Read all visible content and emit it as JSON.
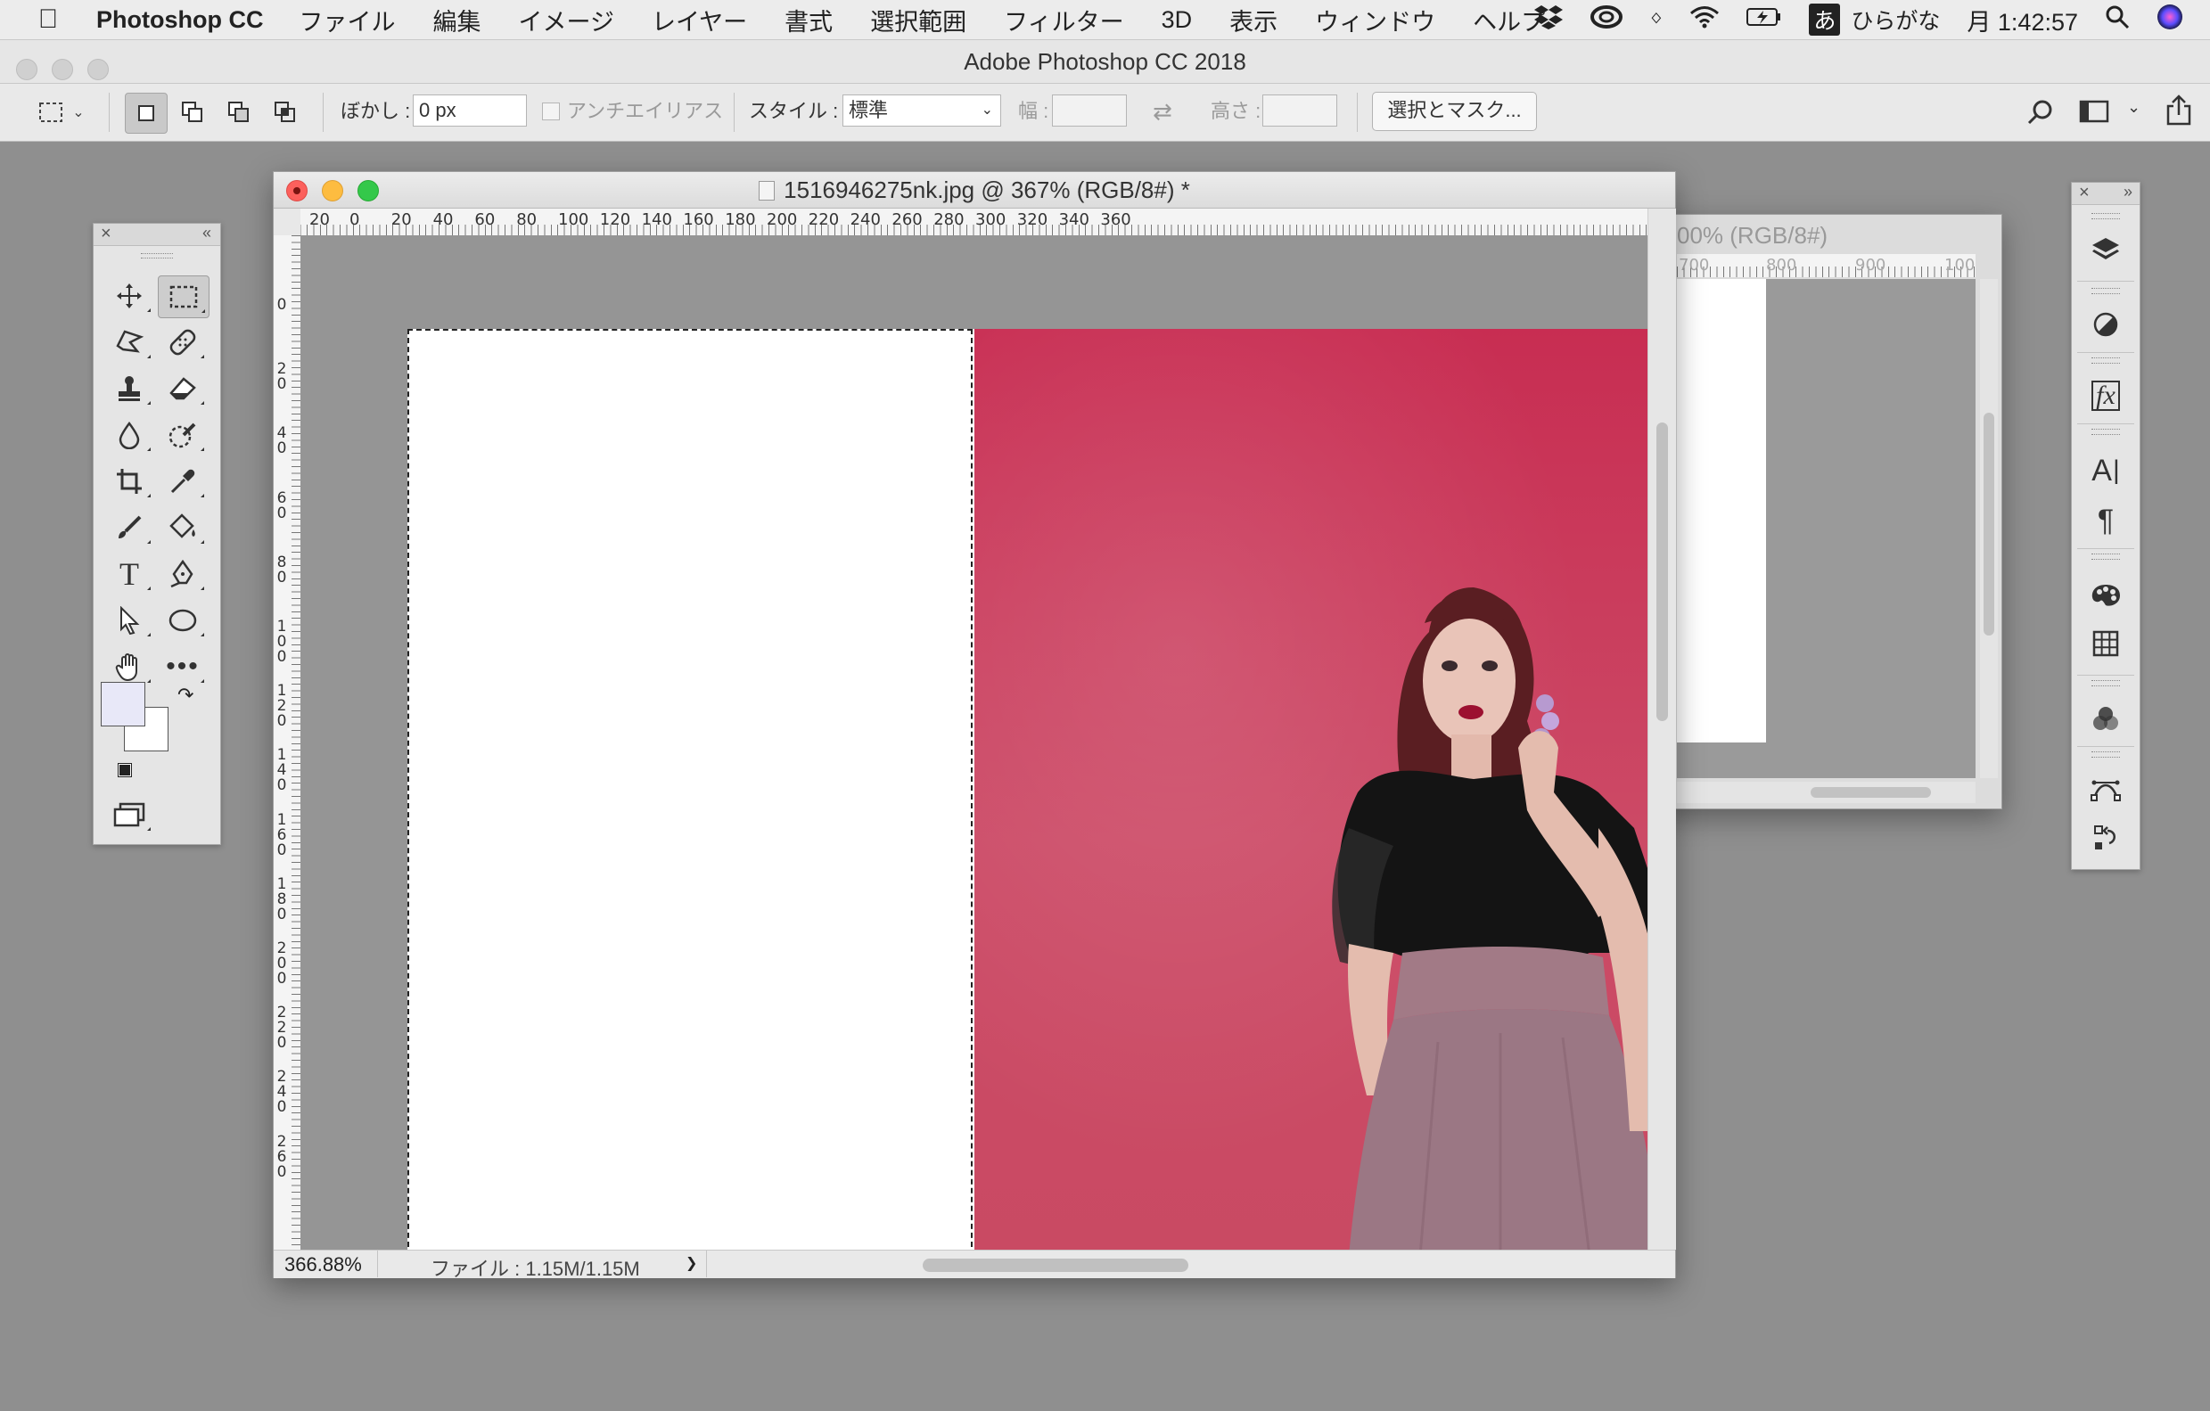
{
  "menubar": {
    "app_name": "Photoshop CC",
    "items": [
      "ファイル",
      "編集",
      "イメージ",
      "レイヤー",
      "書式",
      "選択範囲",
      "フィルター",
      "3D",
      "表示",
      "ウィンドウ",
      "ヘルプ"
    ],
    "ime_mark": "あ",
    "ime_label": "ひらがな",
    "clock": "月 1:42:57"
  },
  "app_title": "Adobe Photoshop CC 2018",
  "options": {
    "feather_label": "ぼかし :",
    "feather_value": "0 px",
    "antialias_label": "アンチエイリアス",
    "style_label": "スタイル :",
    "style_value": "標準",
    "width_label": "幅 :",
    "height_label": "高さ :",
    "select_mask_button": "選択とマスク..."
  },
  "document": {
    "title": "1516946275nk.jpg @ 367% (RGB/8#) *",
    "zoom": "366.88%",
    "file_info": "ファイル : 1.15M/1.15M",
    "status_arrow": "❯",
    "h_ruler_labels": [
      "20",
      "0",
      "20",
      "40",
      "60",
      "80",
      "100",
      "120",
      "140",
      "160",
      "180",
      "200",
      "220",
      "240",
      "260",
      "280",
      "300",
      "320",
      "340",
      "360"
    ],
    "v_ruler_labels": [
      "0",
      "20",
      "40",
      "60",
      "80",
      "100",
      "120",
      "140",
      "160",
      "180",
      "200",
      "220",
      "240",
      "260"
    ]
  },
  "back_document": {
    "title_fragment": "00% (RGB/8#)",
    "ruler_labels": [
      "700",
      "800",
      "900",
      "100"
    ]
  },
  "colors": {
    "foreground": "#e8e8f8",
    "background": "#ffffff",
    "photo_bg": "#c8345a"
  },
  "icons": {
    "tools": [
      "move-icon",
      "marquee-icon",
      "lasso-icon",
      "healing-icon",
      "stamp-icon",
      "eraser-icon",
      "blur-icon",
      "quick-select-icon",
      "crop-icon",
      "eyedropper-icon",
      "brush-icon",
      "paint-bucket-icon",
      "type-icon",
      "pen-icon",
      "path-select-icon",
      "ellipse-icon",
      "hand-icon",
      "more-icon"
    ],
    "right_panel": [
      "layers-icon",
      "adjustments-icon",
      "styles-icon",
      "character-icon",
      "paragraph-icon",
      "swatches-icon",
      "grid-icon",
      "channels-icon",
      "paths-icon",
      "history-icon"
    ]
  }
}
